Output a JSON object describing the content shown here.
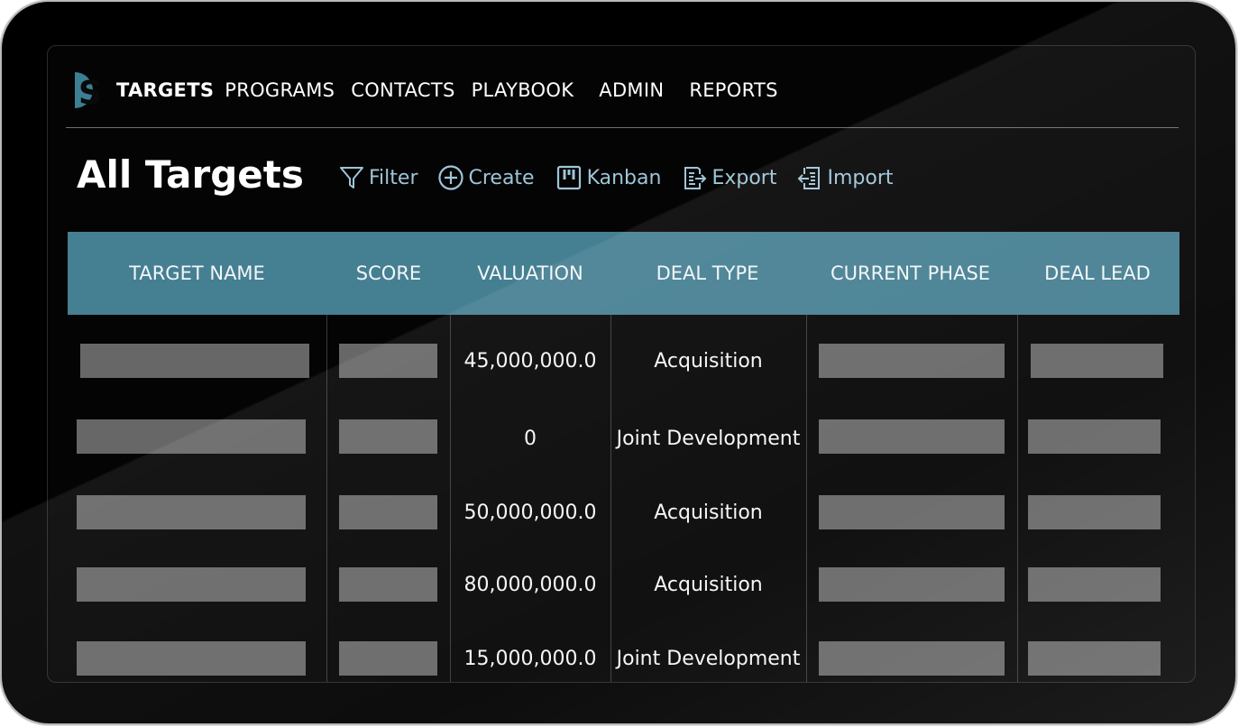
{
  "brand": {
    "logo_letter": "S",
    "logo_color": "#3c7e94"
  },
  "nav": {
    "items": [
      {
        "label": "TARGETS",
        "active": true
      },
      {
        "label": "PROGRAMS",
        "active": false
      },
      {
        "label": "CONTACTS",
        "active": false
      },
      {
        "label": "PLAYBOOK",
        "active": false
      },
      {
        "label": "ADMIN",
        "active": false
      },
      {
        "label": "REPORTS",
        "active": false
      }
    ]
  },
  "page": {
    "title": "All Targets"
  },
  "toolbar": {
    "filter": {
      "label": "Filter",
      "icon": "filter-icon"
    },
    "create": {
      "label": "Create",
      "icon": "plus-circle-icon"
    },
    "kanban": {
      "label": "Kanban",
      "icon": "kanban-icon"
    },
    "export": {
      "label": "Export",
      "icon": "export-icon"
    },
    "import": {
      "label": "Import",
      "icon": "import-icon"
    },
    "accent": "#9ec5d8"
  },
  "table": {
    "header_color": "#457f92",
    "columns": [
      "TARGET NAME",
      "SCORE",
      "VALUATION",
      "DEAL TYPE",
      "CURRENT PHASE",
      "DEAL LEAD"
    ],
    "rows": [
      {
        "valuation": "45,000,000.0",
        "deal_type": "Acquisition"
      },
      {
        "valuation": "0",
        "deal_type": "Joint Development"
      },
      {
        "valuation": "50,000,000.0",
        "deal_type": "Acquisition"
      },
      {
        "valuation": "80,000,000.0",
        "deal_type": "Acquisition"
      },
      {
        "valuation": "15,000,000.0",
        "deal_type": "Joint Development"
      }
    ]
  }
}
